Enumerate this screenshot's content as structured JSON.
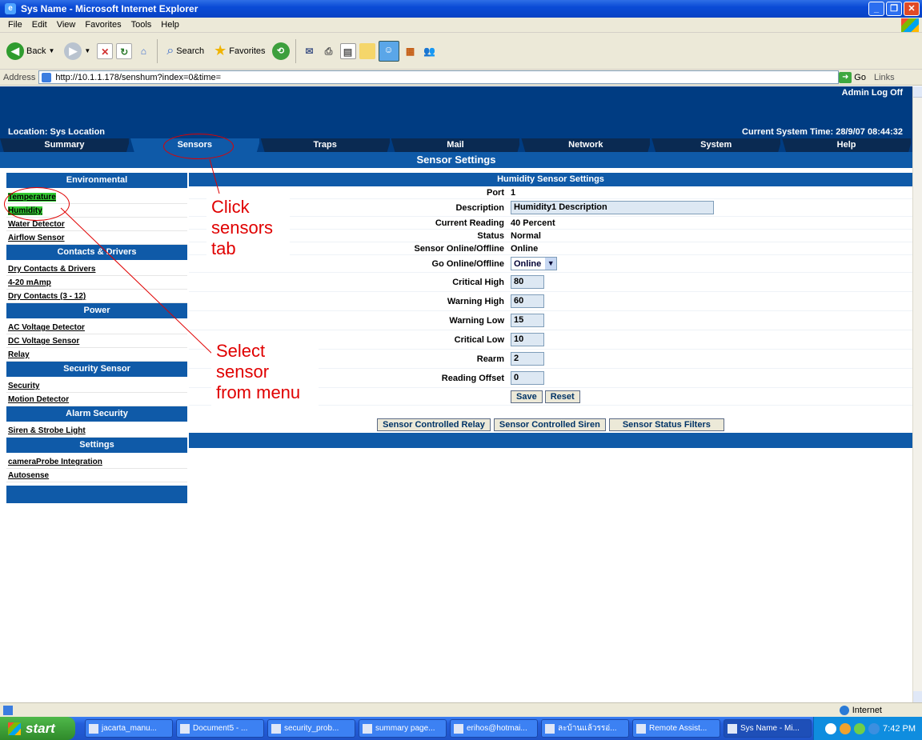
{
  "window": {
    "title": "Sys Name - Microsoft Internet Explorer"
  },
  "menu": [
    "File",
    "Edit",
    "View",
    "Favorites",
    "Tools",
    "Help"
  ],
  "toolbar": {
    "back": "Back",
    "search": "Search",
    "favorites": "Favorites"
  },
  "address": {
    "label": "Address",
    "url": "http://10.1.1.178/senshum?index=0&time=",
    "go": "Go",
    "links": "Links"
  },
  "header": {
    "user": "Admin Log Off",
    "location": "Location: Sys Location",
    "time": "Current System Time: 28/9/07 08:44:32"
  },
  "tabs": [
    "Summary",
    "Sensors",
    "Traps",
    "Mail",
    "Network",
    "System",
    "Help"
  ],
  "page_title": "Sensor Settings",
  "sidebar": {
    "sections": [
      {
        "title": "Environmental",
        "items": [
          "Temperature",
          "Humidity",
          "Water Detector",
          "Airflow Sensor"
        ]
      },
      {
        "title": "Contacts & Drivers",
        "items": [
          "Dry Contacts & Drivers",
          "4-20 mAmp",
          "Dry Contacts (3 - 12)"
        ]
      },
      {
        "title": "Power",
        "items": [
          "AC Voltage Detector",
          "DC Voltage Sensor",
          "Relay"
        ]
      },
      {
        "title": "Security Sensor",
        "items": [
          "Security",
          "Motion Detector"
        ]
      },
      {
        "title": "Alarm Security",
        "items": [
          "Siren & Strobe Light"
        ]
      },
      {
        "title": "Settings",
        "items": [
          "cameraProbe Integration",
          "Autosense"
        ]
      }
    ]
  },
  "form": {
    "title": "Humidity Sensor Settings",
    "port_label": "Port",
    "port": "1",
    "description_label": "Description",
    "description": "Humidity1 Description",
    "reading_label": "Current Reading",
    "reading": "40 Percent",
    "status_label": "Status",
    "status": "Normal",
    "online_label": "Sensor Online/Offline",
    "online": "Online",
    "go_online_label": "Go Online/Offline",
    "go_online": "Online",
    "critical_high_label": "Critical High",
    "critical_high": "80",
    "warning_high_label": "Warning High",
    "warning_high": "60",
    "warning_low_label": "Warning Low",
    "warning_low": "15",
    "critical_low_label": "Critical Low",
    "critical_low": "10",
    "rearm_label": "Rearm",
    "rearm": "2",
    "offset_label": "Reading Offset",
    "offset": "0",
    "save": "Save",
    "reset": "Reset"
  },
  "bottom_buttons": [
    "Sensor Controlled Relay",
    "Sensor Controlled Siren",
    "Sensor Status Filters"
  ],
  "annotations": {
    "click_tab": "Click\nsensors\ntab",
    "select_sensor": "Select\nsensor\nfrom menu"
  },
  "statusbar": {
    "zone": "Internet"
  },
  "taskbar": {
    "start": "start",
    "tasks": [
      "jacarta_manu...",
      "Document5 - ...",
      "security_prob...",
      "summary page...",
      "erihos@hotmai...",
      "ละบ้านแล้วรรอ่...",
      "Remote Assist...",
      "Sys Name - Mi..."
    ],
    "clock": "7:42 PM"
  },
  "colors": {
    "brand": "#003c82",
    "accent": "#0f5aa8",
    "highlight": "#33cc33",
    "annotation": "#e00000"
  }
}
